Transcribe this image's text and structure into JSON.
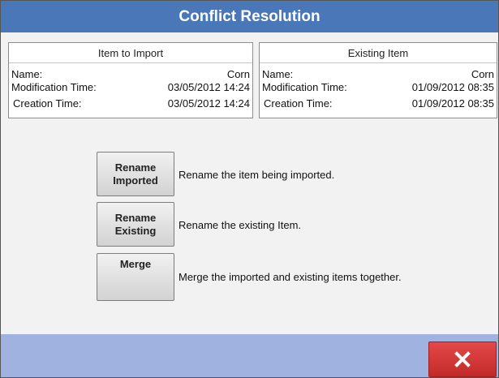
{
  "dialog": {
    "title": "Conflict Resolution"
  },
  "import_panel": {
    "header": "Item to Import",
    "rows": [
      {
        "label": "Name:",
        "value": "Corn"
      },
      {
        "label": "Modification Time:",
        "value": "03/05/2012 14:24"
      },
      {
        "label": "Creation Time:",
        "value": "03/05/2012 14:24"
      }
    ]
  },
  "existing_panel": {
    "header": "Existing Item",
    "rows": [
      {
        "label": "Name:",
        "value": "Corn"
      },
      {
        "label": "Modification Time:",
        "value": "01/09/2012 08:35"
      },
      {
        "label": "Creation Time:",
        "value": "01/09/2012 08:35"
      }
    ]
  },
  "options": [
    {
      "line1": "Rename",
      "line2": "Imported",
      "description": "Rename the item being imported."
    },
    {
      "line1": "Rename",
      "line2": "Existing",
      "description": "Rename the existing Item."
    },
    {
      "line1": "Merge",
      "line2": "",
      "description": "Merge the imported and existing items together."
    }
  ],
  "footer": {
    "close_icon": "close-x-icon",
    "close_color": "#d33a3a",
    "bar_color": "#9fb2e0"
  },
  "colors": {
    "title_bar": "#4a77b7"
  }
}
